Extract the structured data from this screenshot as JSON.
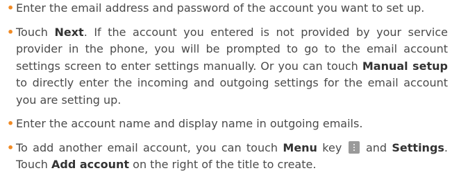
{
  "accent_color": "#f08a24",
  "bullet_glyph": "•",
  "steps": [
    {
      "text_1": "Enter the email address and password of the account you want to set up."
    },
    {
      "text_1": "Touch ",
      "bold_1": "Next",
      "text_2": ". If the account you entered is not provided by your service provider in the phone, you will be prompted to go to the email account settings screen to enter settings manually. Or you can touch ",
      "bold_2": "Manual setup",
      "text_3": " to directly enter the incoming and outgoing settings for the email account you are setting up."
    },
    {
      "text_1": "Enter the account name and display name in outgoing emails."
    },
    {
      "text_1": "To add another email account, you can touch ",
      "bold_1": "Menu",
      "text_2": " key ",
      "icon": "menu-dots-icon",
      "text_3": " and ",
      "bold_2": "Settings",
      "text_4": ". Touch ",
      "bold_3": "Add account",
      "text_5": " on the right of the title to create."
    }
  ]
}
